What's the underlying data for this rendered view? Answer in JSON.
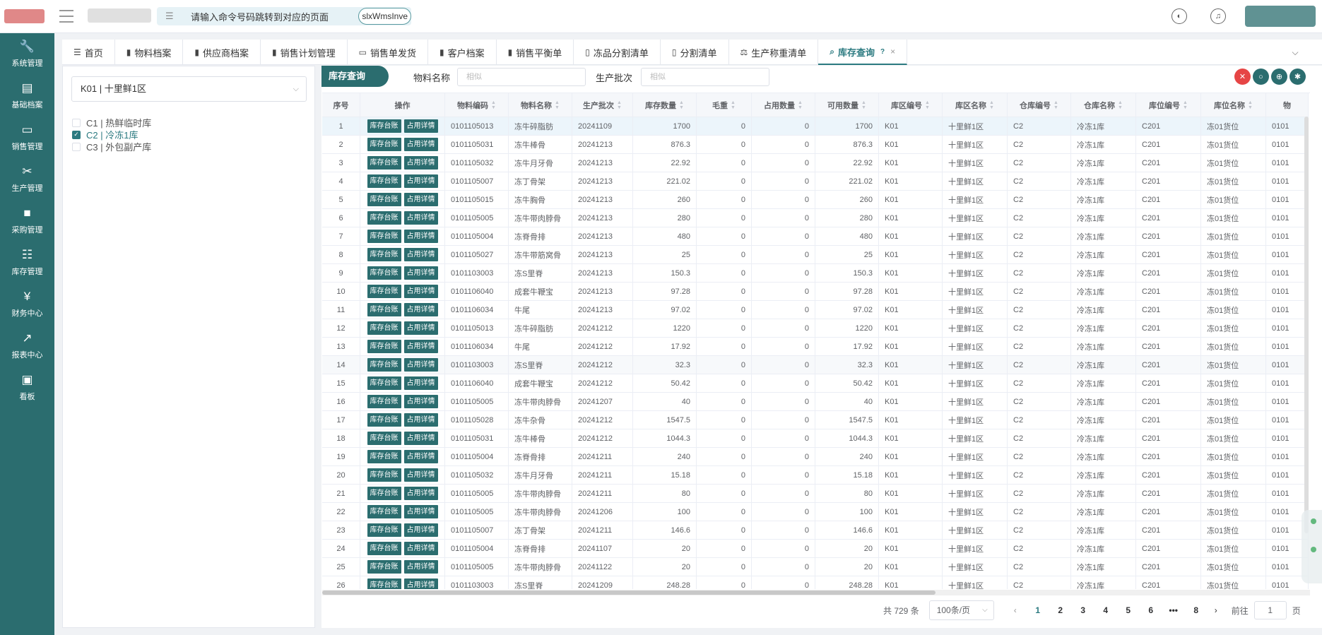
{
  "topbar": {
    "command_placeholder": "请输入命令号码跳转到对应的页面",
    "command_tag": "slxWmsInve"
  },
  "sidebar": {
    "items": [
      {
        "icon": "wrench-icon",
        "label": "系统管理"
      },
      {
        "icon": "book-icon",
        "label": "基础档案"
      },
      {
        "icon": "card-icon",
        "label": "销售管理"
      },
      {
        "icon": "tools-icon",
        "label": "生产管理"
      },
      {
        "icon": "bag-icon",
        "label": "采购管理"
      },
      {
        "icon": "list-icon",
        "label": "库存管理"
      },
      {
        "icon": "yen-icon",
        "label": "财务中心"
      },
      {
        "icon": "chart-icon",
        "label": "报表中心"
      },
      {
        "icon": "board-icon",
        "label": "看板"
      }
    ]
  },
  "tabs": [
    {
      "label": "首页"
    },
    {
      "label": "物料档案"
    },
    {
      "label": "供应商档案"
    },
    {
      "label": "销售计划管理"
    },
    {
      "label": "销售单发货"
    },
    {
      "label": "客户档案"
    },
    {
      "label": "销售平衡单"
    },
    {
      "label": "冻品分割清单"
    },
    {
      "label": "分割清单"
    },
    {
      "label": "生产称重清单"
    },
    {
      "label": "库存查询",
      "active": true
    }
  ],
  "tree": {
    "select_value": "K01 | 十里鲜1区",
    "items": [
      {
        "label": "C1 | 热鲜临时库",
        "checked": false
      },
      {
        "label": "C2 | 冷冻1库",
        "checked": true
      },
      {
        "label": "C3 | 外包副产库",
        "checked": false
      }
    ]
  },
  "query": {
    "title": "库存查询",
    "material_label": "物料名称",
    "material_placeholder": "相似",
    "batch_label": "生产批次",
    "batch_placeholder": "相似"
  },
  "table": {
    "headers": [
      "序号",
      "操作",
      "物料编码",
      "物料名称",
      "生产批次",
      "库存数量",
      "毛重",
      "占用数量",
      "可用数量",
      "库区编号",
      "库区名称",
      "仓库编号",
      "仓库名称",
      "库位编号",
      "库位名称",
      "物"
    ],
    "op_labels": [
      "库存台账",
      "占用详情"
    ],
    "rows": [
      [
        "1",
        "0101105013",
        "冻牛碎脂肪",
        "20241109",
        "1700",
        "0",
        "0",
        "1700",
        "K01",
        "十里鲜1区",
        "C2",
        "冷冻1库",
        "C201",
        "冻01货位",
        "0101"
      ],
      [
        "2",
        "0101105031",
        "冻牛棒骨",
        "20241213",
        "876.3",
        "0",
        "0",
        "876.3",
        "K01",
        "十里鲜1区",
        "C2",
        "冷冻1库",
        "C201",
        "冻01货位",
        "0101"
      ],
      [
        "3",
        "0101105032",
        "冻牛月牙骨",
        "20241213",
        "22.92",
        "0",
        "0",
        "22.92",
        "K01",
        "十里鲜1区",
        "C2",
        "冷冻1库",
        "C201",
        "冻01货位",
        "0101"
      ],
      [
        "4",
        "0101105007",
        "冻丁骨架",
        "20241213",
        "221.02",
        "0",
        "0",
        "221.02",
        "K01",
        "十里鲜1区",
        "C2",
        "冷冻1库",
        "C201",
        "冻01货位",
        "0101"
      ],
      [
        "5",
        "0101105015",
        "冻牛胸骨",
        "20241213",
        "260",
        "0",
        "0",
        "260",
        "K01",
        "十里鲜1区",
        "C2",
        "冷冻1库",
        "C201",
        "冻01货位",
        "0101"
      ],
      [
        "6",
        "0101105005",
        "冻牛带肉脖骨",
        "20241213",
        "280",
        "0",
        "0",
        "280",
        "K01",
        "十里鲜1区",
        "C2",
        "冷冻1库",
        "C201",
        "冻01货位",
        "0101"
      ],
      [
        "7",
        "0101105004",
        "冻脊骨排",
        "20241213",
        "480",
        "0",
        "0",
        "480",
        "K01",
        "十里鲜1区",
        "C2",
        "冷冻1库",
        "C201",
        "冻01货位",
        "0101"
      ],
      [
        "8",
        "0101105027",
        "冻牛带筋窝骨",
        "20241213",
        "25",
        "0",
        "0",
        "25",
        "K01",
        "十里鲜1区",
        "C2",
        "冷冻1库",
        "C201",
        "冻01货位",
        "0101"
      ],
      [
        "9",
        "0101103003",
        "冻S里脊",
        "20241213",
        "150.3",
        "0",
        "0",
        "150.3",
        "K01",
        "十里鲜1区",
        "C2",
        "冷冻1库",
        "C201",
        "冻01货位",
        "0101"
      ],
      [
        "10",
        "0101106040",
        "成套牛鞭宝",
        "20241213",
        "97.28",
        "0",
        "0",
        "97.28",
        "K01",
        "十里鲜1区",
        "C2",
        "冷冻1库",
        "C201",
        "冻01货位",
        "0101"
      ],
      [
        "11",
        "0101106034",
        "牛尾",
        "20241213",
        "97.02",
        "0",
        "0",
        "97.02",
        "K01",
        "十里鲜1区",
        "C2",
        "冷冻1库",
        "C201",
        "冻01货位",
        "0101"
      ],
      [
        "12",
        "0101105013",
        "冻牛碎脂肪",
        "20241212",
        "1220",
        "0",
        "0",
        "1220",
        "K01",
        "十里鲜1区",
        "C2",
        "冷冻1库",
        "C201",
        "冻01货位",
        "0101"
      ],
      [
        "13",
        "0101106034",
        "牛尾",
        "20241212",
        "17.92",
        "0",
        "0",
        "17.92",
        "K01",
        "十里鲜1区",
        "C2",
        "冷冻1库",
        "C201",
        "冻01货位",
        "0101"
      ],
      [
        "14",
        "0101103003",
        "冻S里脊",
        "20241212",
        "32.3",
        "0",
        "0",
        "32.3",
        "K01",
        "十里鲜1区",
        "C2",
        "冷冻1库",
        "C201",
        "冻01货位",
        "0101"
      ],
      [
        "15",
        "0101106040",
        "成套牛鞭宝",
        "20241212",
        "50.42",
        "0",
        "0",
        "50.42",
        "K01",
        "十里鲜1区",
        "C2",
        "冷冻1库",
        "C201",
        "冻01货位",
        "0101"
      ],
      [
        "16",
        "0101105005",
        "冻牛带肉脖骨",
        "20241207",
        "40",
        "0",
        "0",
        "40",
        "K01",
        "十里鲜1区",
        "C2",
        "冷冻1库",
        "C201",
        "冻01货位",
        "0101"
      ],
      [
        "17",
        "0101105028",
        "冻牛杂骨",
        "20241212",
        "1547.5",
        "0",
        "0",
        "1547.5",
        "K01",
        "十里鲜1区",
        "C2",
        "冷冻1库",
        "C201",
        "冻01货位",
        "0101"
      ],
      [
        "18",
        "0101105031",
        "冻牛棒骨",
        "20241212",
        "1044.3",
        "0",
        "0",
        "1044.3",
        "K01",
        "十里鲜1区",
        "C2",
        "冷冻1库",
        "C201",
        "冻01货位",
        "0101"
      ],
      [
        "19",
        "0101105004",
        "冻脊骨排",
        "20241211",
        "240",
        "0",
        "0",
        "240",
        "K01",
        "十里鲜1区",
        "C2",
        "冷冻1库",
        "C201",
        "冻01货位",
        "0101"
      ],
      [
        "20",
        "0101105032",
        "冻牛月牙骨",
        "20241211",
        "15.18",
        "0",
        "0",
        "15.18",
        "K01",
        "十里鲜1区",
        "C2",
        "冷冻1库",
        "C201",
        "冻01货位",
        "0101"
      ],
      [
        "21",
        "0101105005",
        "冻牛带肉脖骨",
        "20241211",
        "80",
        "0",
        "0",
        "80",
        "K01",
        "十里鲜1区",
        "C2",
        "冷冻1库",
        "C201",
        "冻01货位",
        "0101"
      ],
      [
        "22",
        "0101105005",
        "冻牛带肉脖骨",
        "20241206",
        "100",
        "0",
        "0",
        "100",
        "K01",
        "十里鲜1区",
        "C2",
        "冷冻1库",
        "C201",
        "冻01货位",
        "0101"
      ],
      [
        "23",
        "0101105007",
        "冻丁骨架",
        "20241211",
        "146.6",
        "0",
        "0",
        "146.6",
        "K01",
        "十里鲜1区",
        "C2",
        "冷冻1库",
        "C201",
        "冻01货位",
        "0101"
      ],
      [
        "24",
        "0101105004",
        "冻脊骨排",
        "20241107",
        "20",
        "0",
        "0",
        "20",
        "K01",
        "十里鲜1区",
        "C2",
        "冷冻1库",
        "C201",
        "冻01货位",
        "0101"
      ],
      [
        "25",
        "0101105005",
        "冻牛带肉脖骨",
        "20241122",
        "20",
        "0",
        "0",
        "20",
        "K01",
        "十里鲜1区",
        "C2",
        "冷冻1库",
        "C201",
        "冻01货位",
        "0101"
      ],
      [
        "26",
        "0101103003",
        "冻S里脊",
        "20241209",
        "248.28",
        "0",
        "0",
        "248.28",
        "K01",
        "十里鲜1区",
        "C2",
        "冷冻1库",
        "C201",
        "冻01货位",
        "0101"
      ]
    ]
  },
  "pager": {
    "total": "共 729 条",
    "page_size": "100条/页",
    "pages": [
      "1",
      "2",
      "3",
      "4",
      "5",
      "6",
      "•••",
      "8"
    ],
    "goto_label": "前往",
    "goto_value": "1",
    "page_unit": "页"
  }
}
